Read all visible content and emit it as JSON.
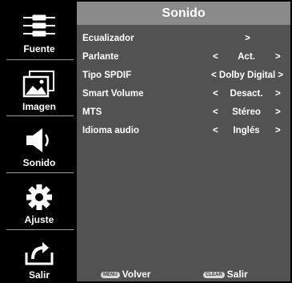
{
  "sidebar": {
    "items": [
      {
        "label": "Fuente",
        "icon": "source-connector-icon"
      },
      {
        "label": "Imagen",
        "icon": "picture-icon"
      },
      {
        "label": "Sonido",
        "icon": "speaker-icon"
      },
      {
        "label": "Ajuste",
        "icon": "gear-icon"
      },
      {
        "label": "Salir",
        "icon": "exit-icon"
      }
    ]
  },
  "panel": {
    "title": "Sonido",
    "rows": [
      {
        "name": "Ecualizador",
        "value": "",
        "enter": ">"
      },
      {
        "name": "Parlante",
        "left": "<",
        "value": "Act.",
        "right": ">"
      },
      {
        "name": "Tipo SPDIF",
        "value": "< Dolby Digital >"
      },
      {
        "name": "Smart Volume",
        "left": "<",
        "value": "Desact.",
        "right": ">"
      },
      {
        "name": "MTS",
        "left": "<",
        "value": "Stéreo",
        "right": ">"
      },
      {
        "name": "Idioma audio",
        "left": "<",
        "value": "Inglés",
        "right": ">"
      }
    ]
  },
  "footer": {
    "menu_key": "MENU",
    "back_label": "Volver",
    "clear_key": "CLEAR",
    "exit_label": "Salir"
  },
  "colors": {
    "panel": "#525252",
    "header": "#8a8a8a",
    "sidebar": "#000000"
  }
}
